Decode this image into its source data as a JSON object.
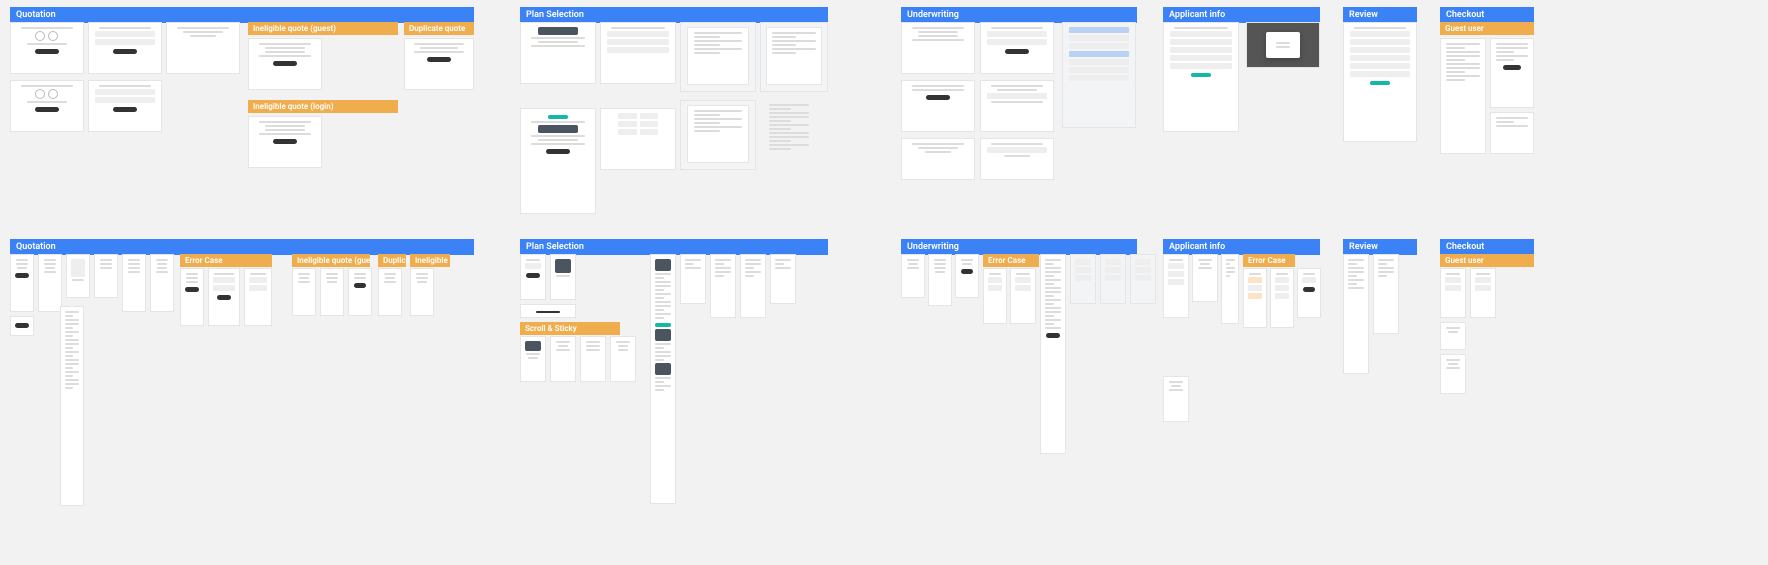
{
  "row1": {
    "quotation": {
      "title": "Quotation",
      "sub_ineligible_guest": "Ineligible quote (guest)",
      "sub_duplicate": "Duplicate quote",
      "sub_ineligible_login": "Ineligible quote (login)"
    },
    "plan_selection": {
      "title": "Plan Selection"
    },
    "underwriting": {
      "title": "Underwriting"
    },
    "applicant_info": {
      "title": "Applicant info"
    },
    "review": {
      "title": "Review"
    },
    "checkout": {
      "title": "Checkout",
      "sub_guest": "Guest user"
    }
  },
  "row2": {
    "quotation": {
      "title": "Quotation",
      "sub_error": "Error Case",
      "sub_ineligible_guest": "Ineligible quote (guest)",
      "sub_duplicate": "Duplicate",
      "sub_ineligible_login": "Ineligible quote (login)"
    },
    "plan_selection": {
      "title": "Plan Selection",
      "sub_scroll": "Scroll & Sticky"
    },
    "underwriting": {
      "title": "Underwriting",
      "sub_error": "Error Case"
    },
    "applicant_info": {
      "title": "Applicant info",
      "sub_error": "Error Case"
    },
    "review": {
      "title": "Review"
    },
    "checkout": {
      "title": "Checkout",
      "sub_guest": "Guest user"
    }
  }
}
